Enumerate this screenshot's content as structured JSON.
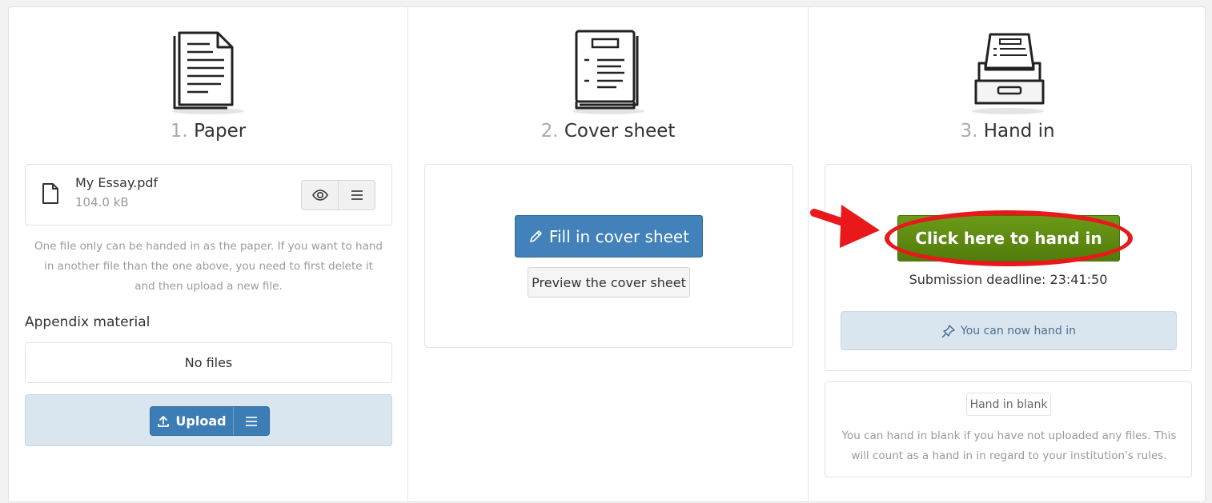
{
  "steps": {
    "paper": {
      "num": "1.",
      "title": "Paper"
    },
    "cover": {
      "num": "2.",
      "title": "Cover sheet"
    },
    "handin": {
      "num": "3.",
      "title": "Hand in"
    }
  },
  "paper": {
    "file_name": "My Essay.pdf",
    "file_size": "104.0 kB",
    "help_text": "One file only can be handed in as the paper. If you want to hand in another file than the one above, you need to first delete it and then upload a new file.",
    "appendix_label": "Appendix material",
    "no_files": "No files",
    "upload_label": "Upload"
  },
  "cover": {
    "fill_label": "Fill in cover sheet",
    "preview_label": "Preview the cover sheet"
  },
  "handin": {
    "button_label": "Click here to hand in",
    "deadline": "Submission deadline: 23:41:50",
    "info": "You can now hand in",
    "blank_label": "Hand in blank",
    "blank_text": "You can hand in blank if you have not uploaded any files. This will count as a hand in in regard to your institution's rules."
  },
  "colors": {
    "primary": "#4281b9",
    "success": "#5f8c12",
    "highlight": "#e8181b",
    "info_bg": "#d9e5ef"
  },
  "icons": [
    "paper-illustration",
    "cover-sheet-illustration",
    "inbox-tray-illustration",
    "file-icon",
    "eye-icon",
    "menu-icon",
    "upload-icon",
    "pencil-icon",
    "pin-icon"
  ]
}
